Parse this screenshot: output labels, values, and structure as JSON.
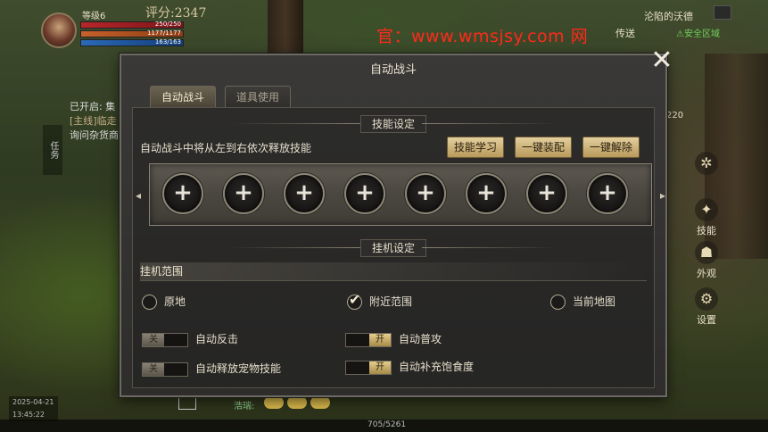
{
  "hud": {
    "level": "等级6",
    "score": "评分:2347",
    "hp": "250/250",
    "mp": "1177/1177",
    "xp": "163/163",
    "site_watermark": "官：www.wmsjsy.com 网",
    "location": "沦陷的沃德",
    "transfer": "传送",
    "safe_zone": "⚠安全区域",
    "number_220": "220",
    "task_tab": "任务",
    "quest_line1": "已开启: 集",
    "quest_line2": "[主线]临走",
    "quest_line3": "询问杂货商",
    "right_buttons": [
      "技能",
      "外观",
      "设置"
    ],
    "date": "2025-04-21",
    "time": "13:45:22",
    "chat": "浩瑞:",
    "exp_text": "705/5261"
  },
  "dialog": {
    "title": "自动战斗",
    "close_symbol": "✕",
    "tabs": [
      {
        "label": "自动战斗",
        "active": true
      },
      {
        "label": "道具使用",
        "active": false
      }
    ],
    "skill_section": {
      "header": "技能设定",
      "description": "自动战斗中将从左到右依次释放技能",
      "buttons": [
        "技能学习",
        "一键装配",
        "一键解除"
      ],
      "slots": [
        "+",
        "+",
        "+",
        "+",
        "+",
        "+",
        "+",
        "+"
      ]
    },
    "idle_section": {
      "header": "挂机设定",
      "range_title": "挂机范围",
      "range_options": [
        {
          "label": "原地",
          "selected": false
        },
        {
          "label": "附近范围",
          "selected": true
        },
        {
          "label": "当前地图",
          "selected": false
        }
      ],
      "toggles": [
        {
          "label": "自动反击",
          "state": "关",
          "on": false
        },
        {
          "label": "自动普攻",
          "state": "开",
          "on": true
        },
        {
          "label": "自动释放宠物技能",
          "state": "关",
          "on": false
        },
        {
          "label": "自动补充饱食度",
          "state": "开",
          "on": true
        }
      ]
    }
  }
}
